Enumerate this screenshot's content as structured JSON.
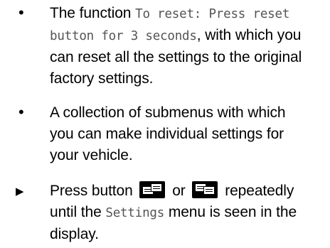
{
  "items": [
    {
      "marker": "•",
      "mono_1": "To reset: Press reset",
      "mono_2": "button for 3 seconds",
      "text_pre": "The function ",
      "text_mid": ", with which you",
      "line_3": "can reset all the settings to the original",
      "line_4": "factory settings."
    },
    {
      "marker": "•",
      "line_1": "A collection of submenus with which",
      "line_2": "you can make individual settings for",
      "line_3": "your vehicle."
    },
    {
      "marker": "▶",
      "text_pre": "Press button",
      "text_or": "or",
      "text_post": "repeatedly",
      "line_2_pre": "until the ",
      "line_2_mono": "Settings",
      "line_2_post": " menu is seen in the",
      "line_3": "display."
    }
  ],
  "icons": [
    "page-back-button-icon",
    "page-forward-button-icon"
  ]
}
